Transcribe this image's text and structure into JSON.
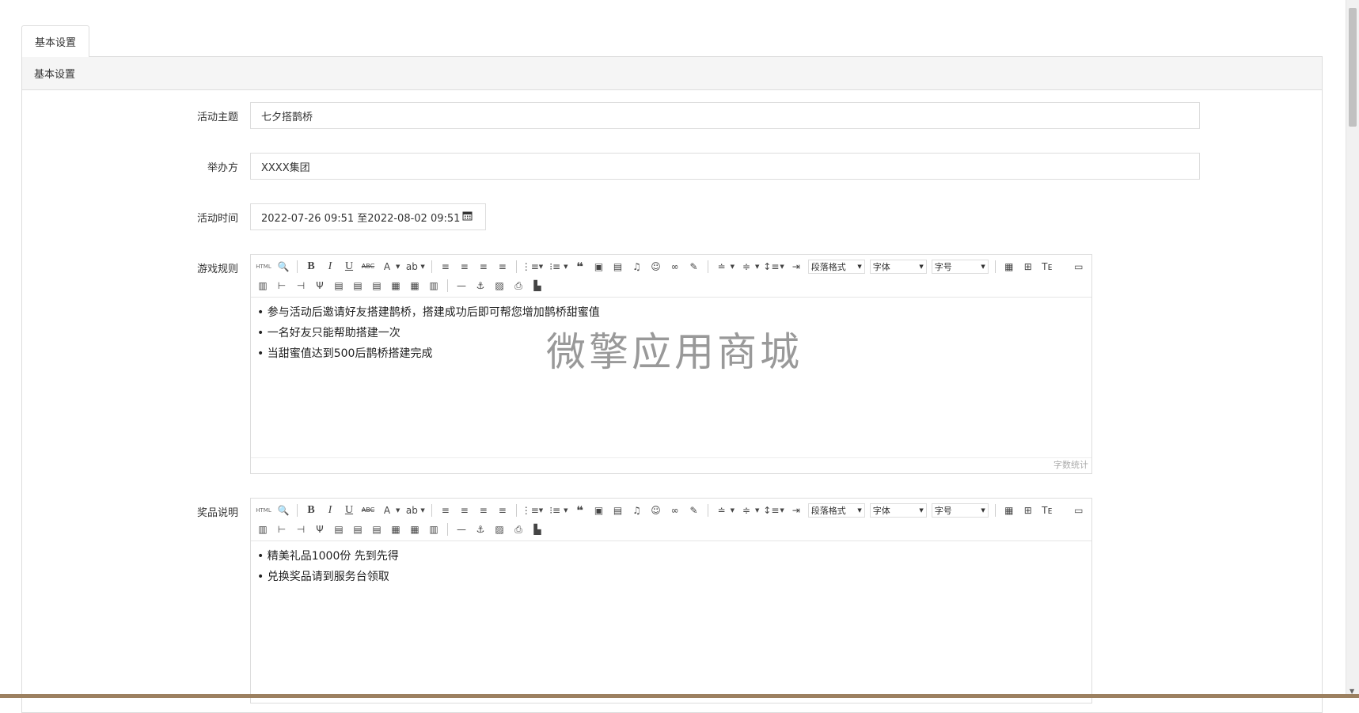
{
  "tab": {
    "label": "基本设置"
  },
  "panel": {
    "heading": "基本设置"
  },
  "fields": {
    "theme": {
      "label": "活动主题",
      "value": "七夕搭鹊桥"
    },
    "organizer": {
      "label": "举办方",
      "value": "XXXX集团"
    },
    "time": {
      "label": "活动时间",
      "value": "2022-07-26 09:51 至2022-08-02 09:51",
      "icon": "calendar-icon"
    },
    "rules": {
      "label": "游戏规则",
      "lines": [
        "参与活动后邀请好友搭建鹊桥，搭建成功后即可帮您增加鹊桥甜蜜值",
        "一名好友只能帮助搭建一次",
        "当甜蜜值达到500后鹊桥搭建完成"
      ]
    },
    "prize": {
      "label": "奖品说明",
      "lines": [
        "精美礼品1000份 先到先得",
        "兑换奖品请到服务台领取"
      ]
    }
  },
  "editor": {
    "html_label": "HTML",
    "paragraph_select": "段落格式",
    "font_select": "字体",
    "size_select": "字号",
    "wordcount_label": "字数统计"
  },
  "watermark": "微擎应用商城"
}
